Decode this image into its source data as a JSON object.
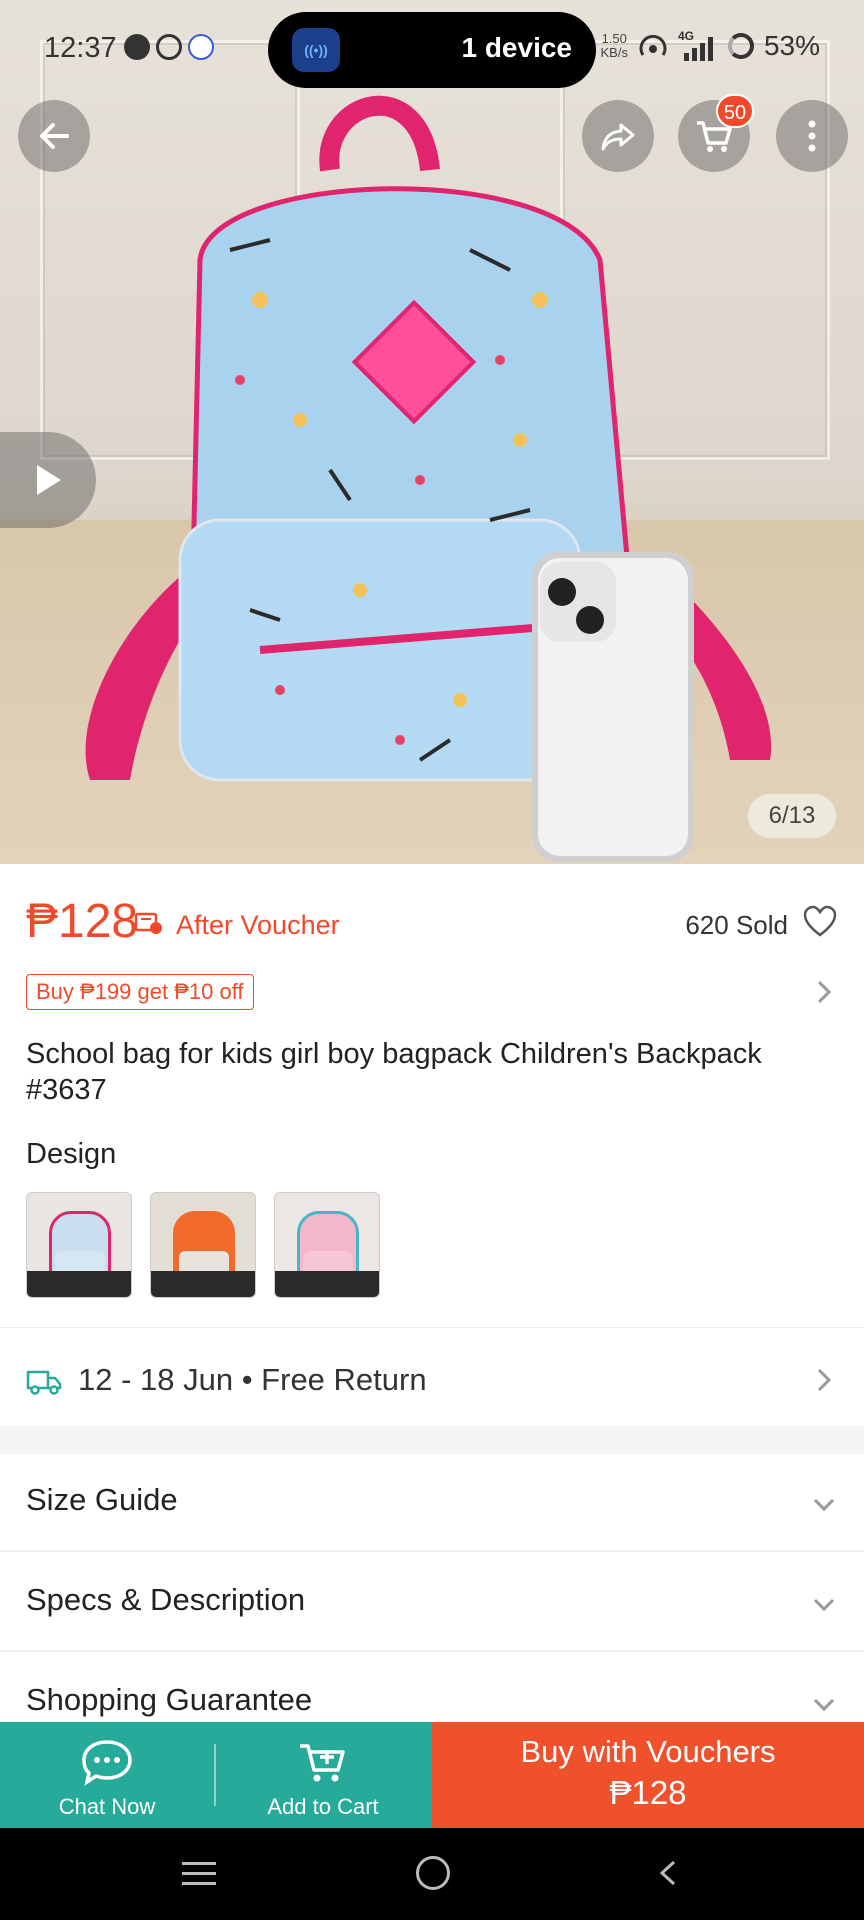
{
  "status_bar": {
    "time": "12:37",
    "cast_pill_label": "1 device",
    "net_speed_value": "1.50",
    "net_speed_unit": "KB/s",
    "network": "4G",
    "battery": "53%"
  },
  "header": {
    "cart_badge": "50",
    "image_counter": "6/13"
  },
  "product": {
    "price": "₱128",
    "after_voucher_label": "After Voucher",
    "sold": "620 Sold",
    "promo": "Buy ₱199 get ₱10 off",
    "title": "School bag for kids girl  boy bagpack Children's Backpack #3637",
    "design_label": "Design",
    "design_options": [
      {
        "name": "design-blue-print"
      },
      {
        "name": "design-orange-print"
      },
      {
        "name": "design-pink-print"
      }
    ]
  },
  "delivery": {
    "text": "12 - 18 Jun • Free Return"
  },
  "sections": {
    "size_guide": "Size Guide",
    "specs": "Specs & Description",
    "guarantee": "Shopping Guarantee"
  },
  "actions": {
    "chat": "Chat Now",
    "add_to_cart": "Add to Cart",
    "buy_line1": "Buy with Vouchers",
    "buy_price": "₱128"
  },
  "colors": {
    "accent": "#f04a2a",
    "teal": "#26aa99",
    "buy": "#f0512d"
  }
}
